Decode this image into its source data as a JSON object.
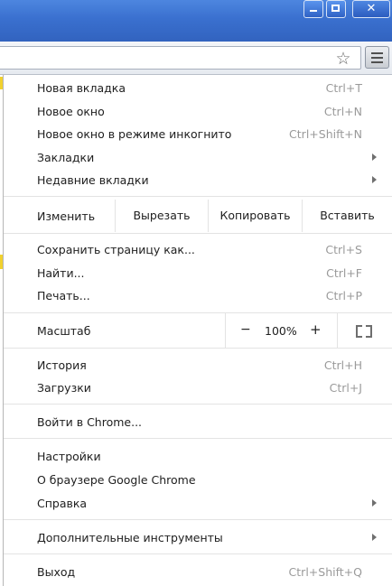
{
  "window": {
    "minimize_label": "▁",
    "maximize_label": "□",
    "close_label": "✕"
  },
  "toolbar": {
    "bookmark_icon": "star-icon",
    "menu_icon": "hamburger-icon"
  },
  "menu": {
    "new_tab": {
      "label": "Новая вкладка",
      "shortcut": "Ctrl+T"
    },
    "new_window": {
      "label": "Новое окно",
      "shortcut": "Ctrl+N"
    },
    "new_incognito": {
      "label": "Новое окно в режиме инкогнито",
      "shortcut": "Ctrl+Shift+N"
    },
    "bookmarks": {
      "label": "Закладки"
    },
    "recent_tabs": {
      "label": "Недавние вкладки"
    },
    "edit": {
      "label": "Изменить",
      "cut": "Вырезать",
      "copy": "Копировать",
      "paste": "Вставить"
    },
    "save_page": {
      "label": "Сохранить страницу как...",
      "shortcut": "Ctrl+S"
    },
    "find": {
      "label": "Найти...",
      "shortcut": "Ctrl+F"
    },
    "print": {
      "label": "Печать...",
      "shortcut": "Ctrl+P"
    },
    "zoom": {
      "label": "Масштаб",
      "minus": "−",
      "value": "100%",
      "plus": "+"
    },
    "history": {
      "label": "История",
      "shortcut": "Ctrl+H"
    },
    "downloads": {
      "label": "Загрузки",
      "shortcut": "Ctrl+J"
    },
    "sign_in": {
      "label": "Войти в Chrome..."
    },
    "settings": {
      "label": "Настройки"
    },
    "about": {
      "label": "О браузере Google Chrome"
    },
    "help": {
      "label": "Справка"
    },
    "more_tools": {
      "label": "Дополнительные инструменты"
    },
    "exit": {
      "label": "Выход",
      "shortcut": "Ctrl+Shift+Q"
    }
  }
}
